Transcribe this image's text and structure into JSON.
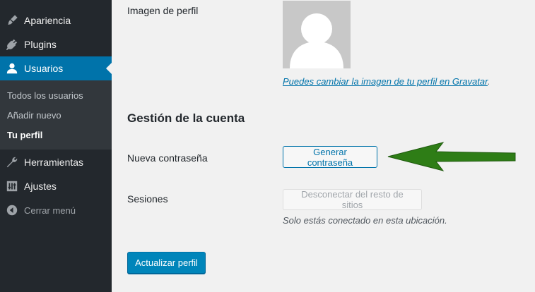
{
  "sidebar": {
    "items": [
      {
        "label": "Apariencia",
        "icon": "paintbrush-icon"
      },
      {
        "label": "Plugins",
        "icon": "plug-icon"
      },
      {
        "label": "Usuarios",
        "icon": "user-icon",
        "active": true
      },
      {
        "label": "Herramientas",
        "icon": "wrench-icon"
      },
      {
        "label": "Ajustes",
        "icon": "settings-sliders-icon"
      }
    ],
    "submenu": [
      {
        "label": "Todos los usuarios"
      },
      {
        "label": "Añadir nuevo"
      },
      {
        "label": "Tu perfil",
        "current": true
      }
    ],
    "collapse_label": "Cerrar menú"
  },
  "profile": {
    "image_label": "Imagen de perfil",
    "gravatar_link": "Puedes cambiar la imagen de tu perfil en Gravatar",
    "gravatar_suffix": "."
  },
  "account": {
    "section_title": "Gestión de la cuenta",
    "new_password_label": "Nueva contraseña",
    "generate_password_button": "Generar contraseña",
    "sessions_label": "Sesiones",
    "logout_others_button": "Desconectar del resto de sitios",
    "sessions_description": "Solo estás conectado en esta ubicación."
  },
  "actions": {
    "update_profile_button": "Actualizar perfil"
  },
  "colors": {
    "sidebar_bg": "#23282d",
    "active_menu": "#0073aa",
    "annotation_arrow": "#2e7d16"
  }
}
